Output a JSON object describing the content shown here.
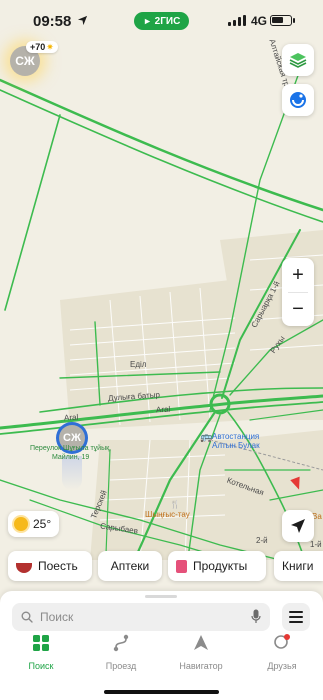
{
  "status_bar": {
    "time": "09:58",
    "network": "4G",
    "app_badge": "2ГИС"
  },
  "profile": {
    "initials": "СЖ",
    "bonus": "+70"
  },
  "map": {
    "streets": {
      "edil": "Еділ",
      "dulyga_batyr": "Дулыға батыр",
      "aral_1": "Aral",
      "aral_2": "Aral",
      "tersken": "Терскей",
      "sarybaev": "Сарыбаев",
      "kotelnaya": "Котельная",
      "saryarka": "Сарыарқа 1-й",
      "rukh": "Рухы",
      "highway": "Алтайская трасса",
      "second": "2-й",
      "first": "1-й"
    },
    "user_marker": {
      "initials": "СЖ",
      "address_line1": "Переулок Шұғыла тұйық,",
      "address_line2": "Майлин, 19"
    },
    "pois": {
      "bus_station_line1": "Автостанция",
      "bus_station_line2": "Алтын Булак",
      "restaurant": "Шыңғыс-тау",
      "edge_label": "Ва"
    }
  },
  "controls": {
    "layers_icon": "layers-icon",
    "compass_icon": "route-compass-icon",
    "zoom_in": "+",
    "zoom_out": "−"
  },
  "weather": {
    "temperature": "25°",
    "icon": "sun-icon"
  },
  "categories": [
    {
      "label": "Поесть",
      "icon": "food-bowl-icon"
    },
    {
      "label": "Аптеки",
      "icon": ""
    },
    {
      "label": "Продукты",
      "icon": "shopping-bag-icon"
    },
    {
      "label": "Книги",
      "icon": ""
    }
  ],
  "search": {
    "placeholder": "Поиск"
  },
  "bottom_nav": [
    {
      "label": "Поиск",
      "active": true
    },
    {
      "label": "Проезд",
      "active": false
    },
    {
      "label": "Навигатор",
      "active": false
    },
    {
      "label": "Друзья",
      "active": false
    }
  ],
  "colors": {
    "brand_green": "#1fa446",
    "road_green": "#3dbb4f",
    "map_background": "#f2efe4",
    "building": "#e6e1cf",
    "user_marker": "#2f6fd6",
    "accent_red": "#e53935"
  }
}
